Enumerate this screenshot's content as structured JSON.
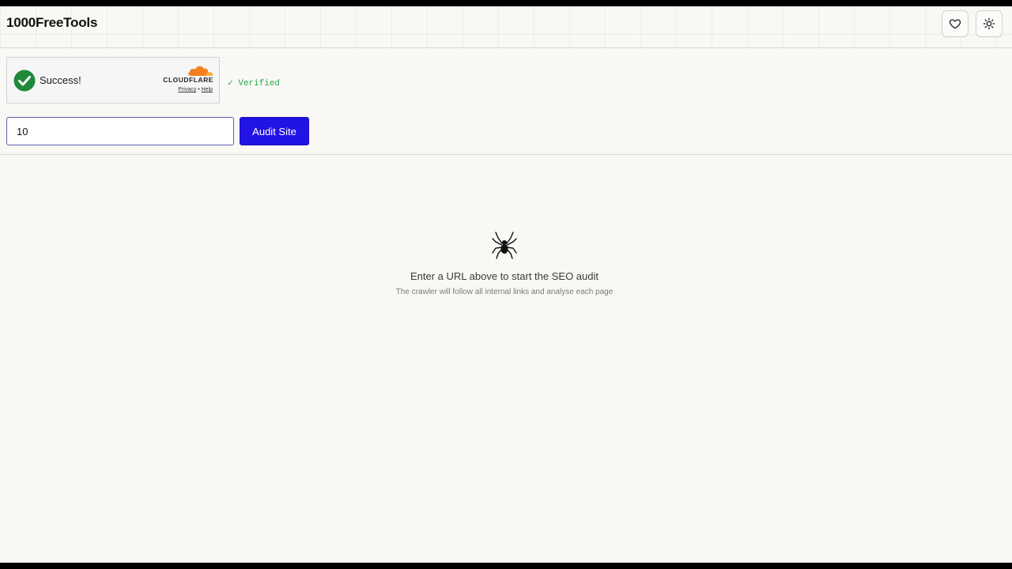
{
  "header": {
    "brand": "1000FreeTools",
    "favorite_icon": "heart-icon",
    "theme_icon": "sun-icon"
  },
  "turnstile": {
    "status": "Success!",
    "provider": "CLOUDFLARE",
    "privacy_link": "Privacy",
    "separator": "•",
    "help_link": "Help",
    "check_color": "#1f8a3b",
    "cloud_colors": [
      "#f38020",
      "#faae40"
    ]
  },
  "verified_text": "✓ Verified",
  "search": {
    "value": "10",
    "button_label": "Audit Site",
    "button_color": "#2113e6"
  },
  "empty_state": {
    "icon": "spider-icon",
    "title": "Enter a URL above to start the SEO audit",
    "subtitle": "The crawler will follow all internal links and analyse each page"
  }
}
